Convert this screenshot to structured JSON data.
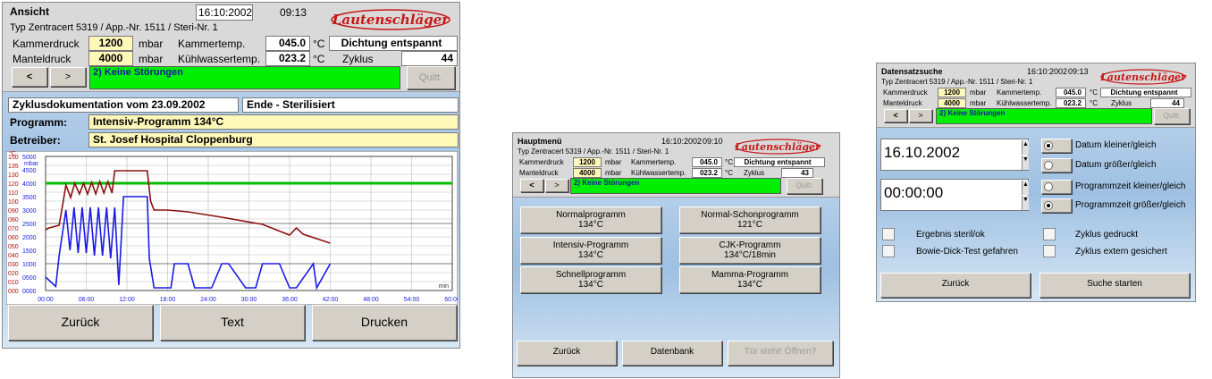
{
  "common": {
    "type_line": "Typ  Zentracert 5319 / App.-Nr. 1511 / Steri-Nr. 1",
    "kammerdruck_label": "Kammerdruck",
    "manteldruck_label": "Manteldruck",
    "kammertemp_label": "Kammertemp.",
    "kuehlwassertemp_label": "Kühlwassertemp.",
    "zyklus_label": "Zyklus",
    "unit_mbar": "mbar",
    "unit_celsius": "°C",
    "kammerdruck": "1200",
    "manteldruck": "4000",
    "kammertemp": "045.0",
    "kuehlwassertemp": "023.2",
    "status": "Dichtung entspannt",
    "prev_label": "<",
    "next_label": ">",
    "message": "2) Keine Störungen",
    "quitt_label": "Quitt.",
    "logo_text": "Lautenschläger"
  },
  "ansicht": {
    "title": "Ansicht",
    "date": "16:10:2002",
    "time": "09:13",
    "zyklus_value": "44",
    "doc_label": "Zyklusdokumentation vom 23.09.2002",
    "doc_status": "Ende - Sterilisiert",
    "programm_label": "Programm:",
    "programm_value": "Intensiv-Programm 134°C",
    "betreiber_label": "Betreiber:",
    "betreiber_value": "St. Josef Hospital Cloppenburg",
    "btn_back": "Zurück",
    "btn_text": "Text",
    "btn_print": "Drucken"
  },
  "chart_data": {
    "type": "line",
    "ylabel_temp": "°C",
    "ylabel_pressure": "mbar",
    "xlabel": "min",
    "x_ticks": [
      "00:00",
      "06:00",
      "12:00",
      "18:00",
      "24:00",
      "30:00",
      "36:00",
      "42:00",
      "48:00",
      "54:00",
      "60:00"
    ],
    "y_ticks_temp": [
      "000",
      "010",
      "020",
      "030",
      "040",
      "050",
      "060",
      "070",
      "080",
      "090",
      "100",
      "110",
      "120",
      "130",
      "135",
      "150"
    ],
    "y_ticks_pressure": [
      "0000",
      "0500",
      "1000",
      "1500",
      "2000",
      "2500",
      "3000",
      "3500",
      "4000",
      "4500",
      "5000"
    ],
    "xlim": [
      0,
      60
    ],
    "reference_line": {
      "name": "Manteldruck",
      "color": "#00bb00",
      "value": 4000
    },
    "series": [
      {
        "color": "#8b1010",
        "x": [
          0,
          0.5,
          2,
          2.5,
          3,
          3.7,
          4.3,
          5,
          5.6,
          6.2,
          6.8,
          7.4,
          8,
          8.6,
          9.2,
          9.8,
          10.2,
          12,
          14,
          15,
          15.5,
          16,
          18,
          21,
          26,
          32,
          36,
          37,
          38,
          42
        ],
        "y": [
          68,
          70,
          73,
          95,
          118,
          104,
          120,
          108,
          120,
          108,
          121,
          108,
          122,
          109,
          122,
          109,
          134,
          134,
          134,
          134,
          100,
          90,
          90,
          88,
          82,
          74,
          62,
          70,
          63,
          53
        ]
      },
      {
        "color": "#1a1ae6",
        "x": [
          0,
          1.5,
          2,
          3,
          3.6,
          4.2,
          4.8,
          5.4,
          6,
          6.6,
          7.2,
          7.8,
          8.4,
          9,
          9.6,
          10.2,
          10.8,
          11.5,
          15,
          15.3,
          16,
          18.5,
          19,
          21,
          22,
          24.5,
          26,
          27,
          29.5,
          31,
          32,
          34.5,
          36,
          37,
          39.5,
          40,
          42
        ],
        "y": [
          500,
          150,
          1300,
          3000,
          1500,
          3100,
          1400,
          3100,
          1400,
          3100,
          1300,
          3100,
          1300,
          3100,
          1200,
          3100,
          200,
          3500,
          3500,
          1200,
          100,
          100,
          1000,
          1000,
          100,
          100,
          1000,
          1000,
          100,
          100,
          1000,
          1000,
          100,
          100,
          1000,
          100,
          1000
        ]
      }
    ]
  },
  "hauptmenu": {
    "title": "Hauptmenü",
    "date": "16:10:2002",
    "time": "09:10",
    "zyklus_value": "43",
    "programs": [
      {
        "name": "Normalprogramm",
        "temp": "134°C"
      },
      {
        "name": "Normal-Schonprogramm",
        "temp": "121°C"
      },
      {
        "name": "Intensiv-Programm",
        "temp": "134°C"
      },
      {
        "name": "CJK-Programm",
        "temp": "134°C/18min"
      },
      {
        "name": "Schnellprogramm",
        "temp": "134°C"
      },
      {
        "name": "Mamma-Programm",
        "temp": "134°C"
      }
    ],
    "btn_back": "Zurück",
    "btn_db": "Datenbank",
    "btn_door": "Tür steht! Öffnen?"
  },
  "datensatz": {
    "title": "Datensatzsuche",
    "date": "16:10:2002",
    "time": "09:13",
    "zyklus_value": "44",
    "date_value": "16.10.2002",
    "time_value": "00:00:00",
    "opt_date_le": "Datum kleiner/gleich",
    "opt_date_ge": "Datum größer/gleich",
    "opt_prog_le": "Programmzeit kleiner/gleich",
    "opt_prog_ge": "Programmzeit größer/gleich",
    "cb_steril": "Ergebnis steril/ok",
    "cb_bowie": "Bowie-Dick-Test gefahren",
    "cb_gedruckt": "Zyklus gedruckt",
    "cb_extern": "Zyklus extern gesichert",
    "btn_back": "Zurück",
    "btn_search": "Suche starten"
  }
}
